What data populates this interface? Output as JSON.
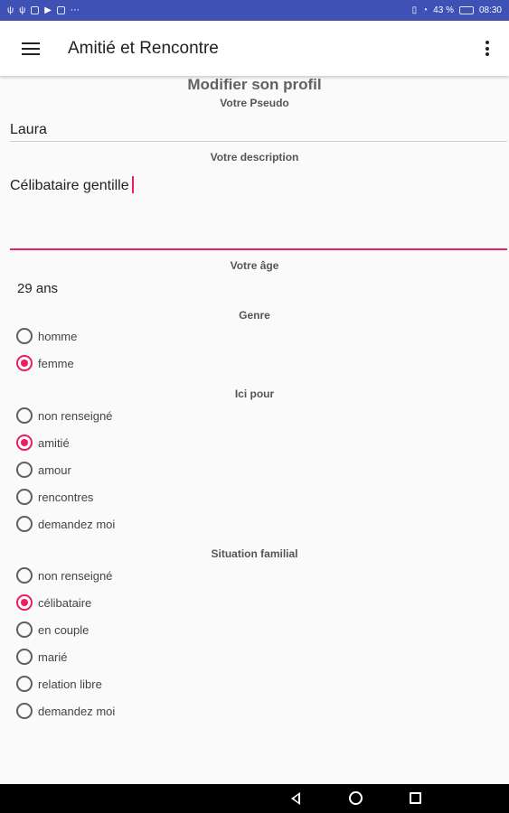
{
  "statusbar": {
    "battery": "43 %",
    "time": "08:30",
    "left_icons": [
      "usb-icon",
      "usb-icon",
      "image-icon",
      "play-icon",
      "mail-icon",
      "more-icon"
    ],
    "right_icons": [
      "vibrate-icon",
      "wifi-icon",
      "battery-charging-icon"
    ]
  },
  "appbar": {
    "title": "Amitié et Rencontre"
  },
  "form": {
    "page_title": "Modifier son profil",
    "pseudo_label": "Votre Pseudo",
    "pseudo_value": "Laura",
    "description_label": "Votre description",
    "description_value": "Célibataire gentille",
    "age_label": "Votre âge",
    "age_value": "29 ans",
    "genre_label": "Genre",
    "genre_options": [
      {
        "label": "homme",
        "checked": false
      },
      {
        "label": "femme",
        "checked": true
      }
    ],
    "ici_label": "Ici pour",
    "ici_options": [
      {
        "label": "non renseigné",
        "checked": false
      },
      {
        "label": "amitié",
        "checked": true
      },
      {
        "label": "amour",
        "checked": false
      },
      {
        "label": "rencontres",
        "checked": false
      },
      {
        "label": "demandez moi",
        "checked": false
      }
    ],
    "situation_label": "Situation familial",
    "situation_options": [
      {
        "label": "non renseigné",
        "checked": false
      },
      {
        "label": "célibataire",
        "checked": true
      },
      {
        "label": "en couple",
        "checked": false
      },
      {
        "label": "marié",
        "checked": false
      },
      {
        "label": "relation libre",
        "checked": false
      },
      {
        "label": "demandez moi",
        "checked": false
      }
    ]
  },
  "colors": {
    "accent": "#e91e63",
    "statusbar": "#3f51b5",
    "navbar": "#000000"
  }
}
